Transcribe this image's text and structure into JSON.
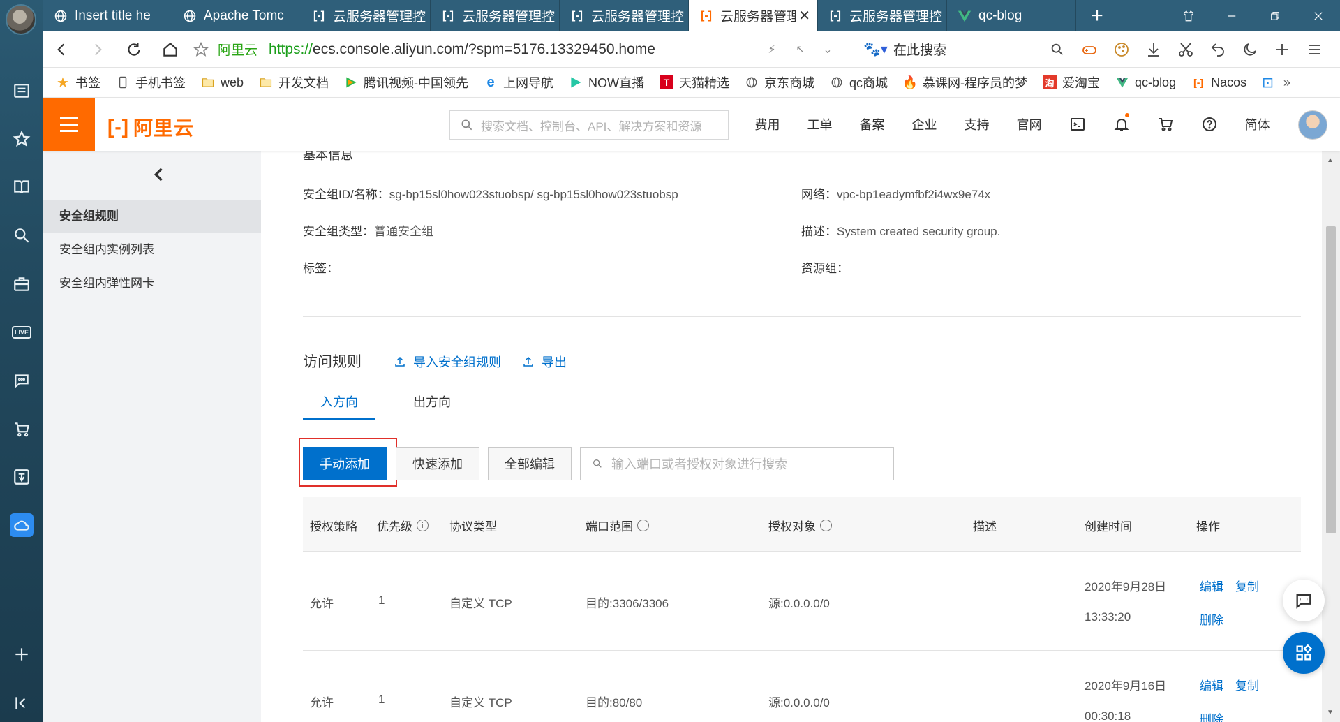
{
  "browser": {
    "tabs": [
      {
        "title": "Insert title he",
        "icon": "globe"
      },
      {
        "title": "Apache Tomc",
        "icon": "globe"
      },
      {
        "title": "云服务器管理控",
        "icon": "aliyun"
      },
      {
        "title": "云服务器管理控",
        "icon": "aliyun"
      },
      {
        "title": "云服务器管理控",
        "icon": "aliyun"
      },
      {
        "title": "云服务器管理",
        "icon": "aliyun",
        "active": true
      },
      {
        "title": "云服务器管理控",
        "icon": "aliyun"
      },
      {
        "title": "qc-blog",
        "icon": "vue"
      }
    ],
    "address": {
      "site_label": "阿里云",
      "url_scheme": "https://",
      "url_rest": "ecs.console.aliyun.com/?spm=5176.13329450.home"
    },
    "search_placeholder": "在此搜索",
    "bookmarks": [
      "书签",
      "手机书签",
      "web",
      "开发文档",
      "腾讯视频-中国领先",
      "上网导航",
      "NOW直播",
      "天猫精选",
      "京东商城",
      "qc商城",
      "慕课网-程序员的梦",
      "爱淘宝",
      "qc-blog",
      "Nacos"
    ]
  },
  "console": {
    "logo_text": "阿里云",
    "search_placeholder": "搜索文档、控制台、API、解决方案和资源",
    "nav": [
      "费用",
      "工单",
      "备案",
      "企业",
      "支持",
      "官网"
    ],
    "lang": "简体"
  },
  "sidebar": {
    "items": [
      {
        "label": "安全组规则",
        "active": true
      },
      {
        "label": "安全组内实例列表"
      },
      {
        "label": "安全组内弹性网卡"
      }
    ]
  },
  "basic_info": {
    "section_title": "基本信息",
    "sg_id_label": "安全组ID/名称：",
    "sg_id_value": "sg-bp15sl0how023stuobsp/ sg-bp15sl0how023stuobsp",
    "network_label": "网络：",
    "network_value": "vpc-bp1eadymfbf2i4wx9e74x",
    "type_label": "安全组类型：",
    "type_value": "普通安全组",
    "desc_label": "描述：",
    "desc_value": "System created security group.",
    "tag_label": "标签：",
    "rg_label": "资源组："
  },
  "rules": {
    "title": "访问规则",
    "import_label": "导入安全组规则",
    "export_label": "导出",
    "tabs": [
      "入方向",
      "出方向"
    ],
    "buttons": {
      "manual_add": "手动添加",
      "quick_add": "快速添加",
      "edit_all": "全部编辑"
    },
    "search_placeholder": "输入端口或者授权对象进行搜索",
    "columns": [
      "授权策略",
      "优先级",
      "协议类型",
      "端口范围",
      "授权对象",
      "描述",
      "创建时间",
      "操作"
    ],
    "rows": [
      {
        "policy": "允许",
        "priority": "1",
        "protocol": "自定义 TCP",
        "port": "目的:3306/3306",
        "source": "源:0.0.0.0/0",
        "date": "2020年9月28日",
        "time": "13:33:20",
        "edit": "编辑",
        "copy": "复制",
        "delete": "删除"
      },
      {
        "policy": "允许",
        "priority": "1",
        "protocol": "自定义 TCP",
        "port": "目的:80/80",
        "source": "源:0.0.0.0/0",
        "date": "2020年9月16日",
        "time": "00:30:18",
        "edit": "编辑",
        "copy": "复制",
        "delete": "删除"
      }
    ]
  },
  "colors": {
    "accent": "#ff6a00",
    "link": "#0070cc",
    "highlight": "#e0302a"
  }
}
